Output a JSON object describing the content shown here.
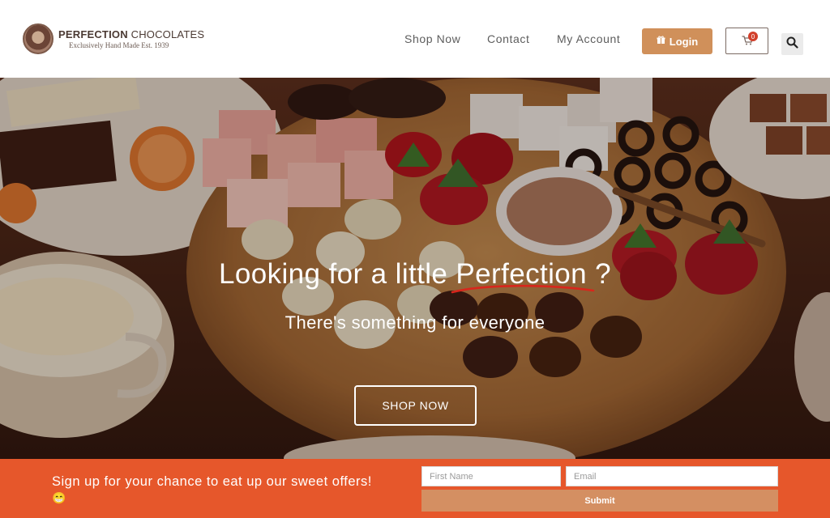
{
  "header": {
    "logo_name_bold": "PERFECTION",
    "logo_name_light": "CHOCOLATES",
    "logo_tagline": "Exclusively Hand Made Est. 1939",
    "nav": [
      {
        "label": "Shop Now"
      },
      {
        "label": "Contact"
      },
      {
        "label": "My Account"
      }
    ],
    "login_label": "Login",
    "cart_count": "0"
  },
  "hero": {
    "title_before": "Looking for a little ",
    "title_highlight": "Perfection",
    "title_after": " ?",
    "subtitle": "There's something for everyone",
    "cta_label": "SHOP NOW"
  },
  "signup": {
    "text": "Sign up for your chance to eat up our sweet offers!",
    "emoji": "😁",
    "first_name_placeholder": "First Name",
    "email_placeholder": "Email",
    "submit_label": "Submit"
  },
  "colors": {
    "accent_orange": "#e6572b",
    "login_tan": "#d0905a",
    "submit_tan": "#d48f62",
    "underline_red": "#d8261c"
  }
}
